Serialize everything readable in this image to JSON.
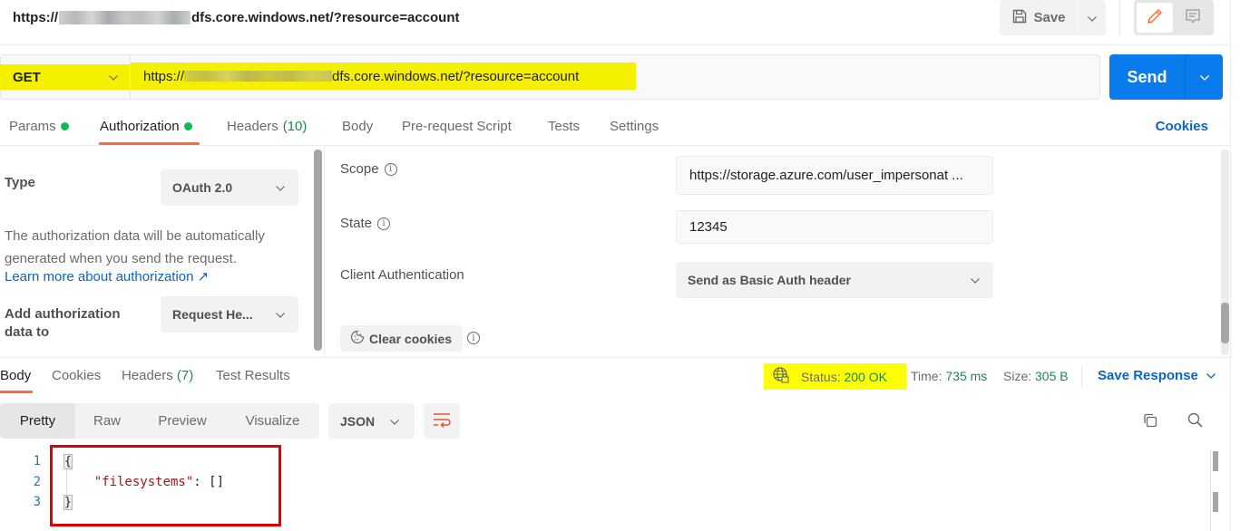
{
  "titlebar": {
    "url_prefix": "https://",
    "url_suffix": "dfs.core.windows.net/?resource=account",
    "save_label": "Save",
    "icons": [
      "save-icon",
      "chevron-down-icon",
      "pencil-icon",
      "comment-icon"
    ]
  },
  "request": {
    "method": "GET",
    "url_prefix": "https://",
    "url_suffix": "dfs.core.windows.net/?resource=account",
    "send_label": "Send"
  },
  "request_tabs": {
    "items": [
      {
        "label": "Params",
        "dot": true
      },
      {
        "label": "Authorization",
        "dot": true,
        "active": true
      },
      {
        "label": "Headers",
        "count": "(10)"
      },
      {
        "label": "Body"
      },
      {
        "label": "Pre-request Script"
      },
      {
        "label": "Tests"
      },
      {
        "label": "Settings"
      }
    ],
    "cookies_label": "Cookies"
  },
  "auth": {
    "type_label": "Type",
    "type_value": "OAuth 2.0",
    "description": "The authorization data will be automatically generated when you send the request.",
    "learn_more": "Learn more about authorization ↗",
    "add_to_label": "Add authorization data to",
    "add_to_value": "Request He...",
    "fields": {
      "scope_label": "Scope",
      "scope_value": "https://storage.azure.com/user_impersonat ...",
      "state_label": "State",
      "state_value": "12345",
      "client_auth_label": "Client Authentication",
      "client_auth_value": "Send as Basic Auth header"
    },
    "clear_cookies_label": "Clear cookies"
  },
  "response": {
    "tabs": [
      {
        "label": "Body",
        "active": true
      },
      {
        "label": "Cookies"
      },
      {
        "label": "Headers",
        "count": "(7)"
      },
      {
        "label": "Test Results"
      }
    ],
    "status_label": "Status:",
    "status_value": "200 OK",
    "time_label": "Time:",
    "time_value": "735 ms",
    "size_label": "Size:",
    "size_value": "305 B",
    "save_response_label": "Save Response",
    "views": [
      "Pretty",
      "Raw",
      "Preview",
      "Visualize"
    ],
    "active_view": "Pretty",
    "format": "JSON",
    "code": {
      "line_numbers": [
        "1",
        "2",
        "3"
      ],
      "open_brace": "{",
      "key": "\"filesystems\"",
      "colon": ": ",
      "value": "[]",
      "close_brace": "}"
    }
  },
  "colors": {
    "accent_orange": "#ff6c37",
    "send_blue": "#097bed",
    "link_blue": "#0b65c2",
    "status_green": "#1d8a4e",
    "highlight_yellow": "#f4f000",
    "annotation_red": "#e00000"
  }
}
